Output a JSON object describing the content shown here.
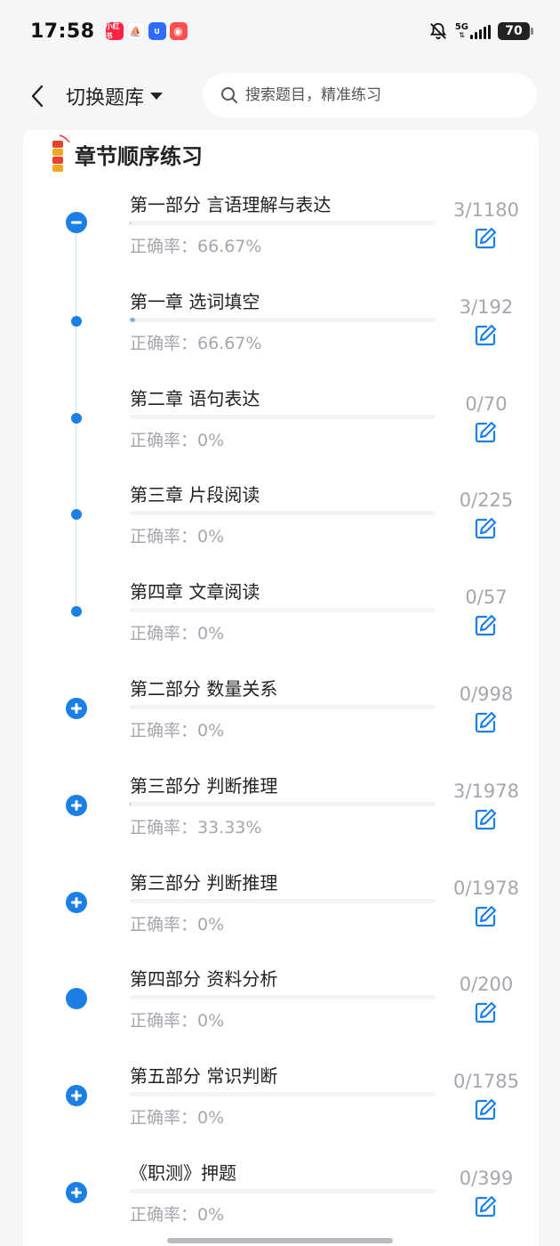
{
  "status_bar": {
    "time": "17:58",
    "network": "5G",
    "battery": "70",
    "app_icons": [
      {
        "name": "xiaohongshu-app-icon",
        "label": "小红书",
        "color": "#ff2442"
      },
      {
        "name": "boat-app-icon",
        "label": "",
        "color": "#ffffff"
      },
      {
        "name": "u-app-icon",
        "label": "U",
        "color": "#2f6bff"
      },
      {
        "name": "game-app-icon",
        "label": "",
        "color": "#ff4f4f"
      }
    ]
  },
  "header": {
    "switch_label": "切换题库",
    "search_placeholder": "搜索题目，精准练习"
  },
  "section": {
    "title": "章节顺序练习"
  },
  "colors": {
    "accent": "#1b7fe6",
    "muted_text": "#a4a7ad"
  },
  "rows": [
    {
      "title": "第一部分 言语理解与表达",
      "rate": "正确率：66.67%",
      "count": "3/1180",
      "icon": "minus",
      "progress": 0.003
    },
    {
      "title": "第一章 选词填空",
      "rate": "正确率：66.67%",
      "count": "3/192",
      "icon": "dot",
      "progress": 0.016
    },
    {
      "title": "第二章 语句表达",
      "rate": "正确率：0%",
      "count": "0/70",
      "icon": "dot",
      "progress": 0
    },
    {
      "title": "第三章 片段阅读",
      "rate": "正确率：0%",
      "count": "0/225",
      "icon": "dot",
      "progress": 0
    },
    {
      "title": "第四章 文章阅读",
      "rate": "正确率：0%",
      "count": "0/57",
      "icon": "dot",
      "progress": 0
    },
    {
      "title": "第二部分 数量关系",
      "rate": "正确率：0%",
      "count": "0/998",
      "icon": "plus",
      "progress": 0
    },
    {
      "title": "第三部分 判断推理",
      "rate": "正确率：33.33%",
      "count": "3/1978",
      "icon": "plus",
      "progress": 0.0015
    },
    {
      "title": "第三部分 判断推理",
      "rate": "正确率：0%",
      "count": "0/1978",
      "icon": "plus",
      "progress": 0
    },
    {
      "title": "第四部分 资料分析",
      "rate": "正确率：0%",
      "count": "0/200",
      "icon": "circle",
      "progress": 0
    },
    {
      "title": "第五部分 常识判断",
      "rate": "正确率：0%",
      "count": "0/1785",
      "icon": "plus",
      "progress": 0
    },
    {
      "title": "《职测》押题",
      "rate": "正确率：0%",
      "count": "0/399",
      "icon": "plus",
      "progress": 0
    }
  ]
}
